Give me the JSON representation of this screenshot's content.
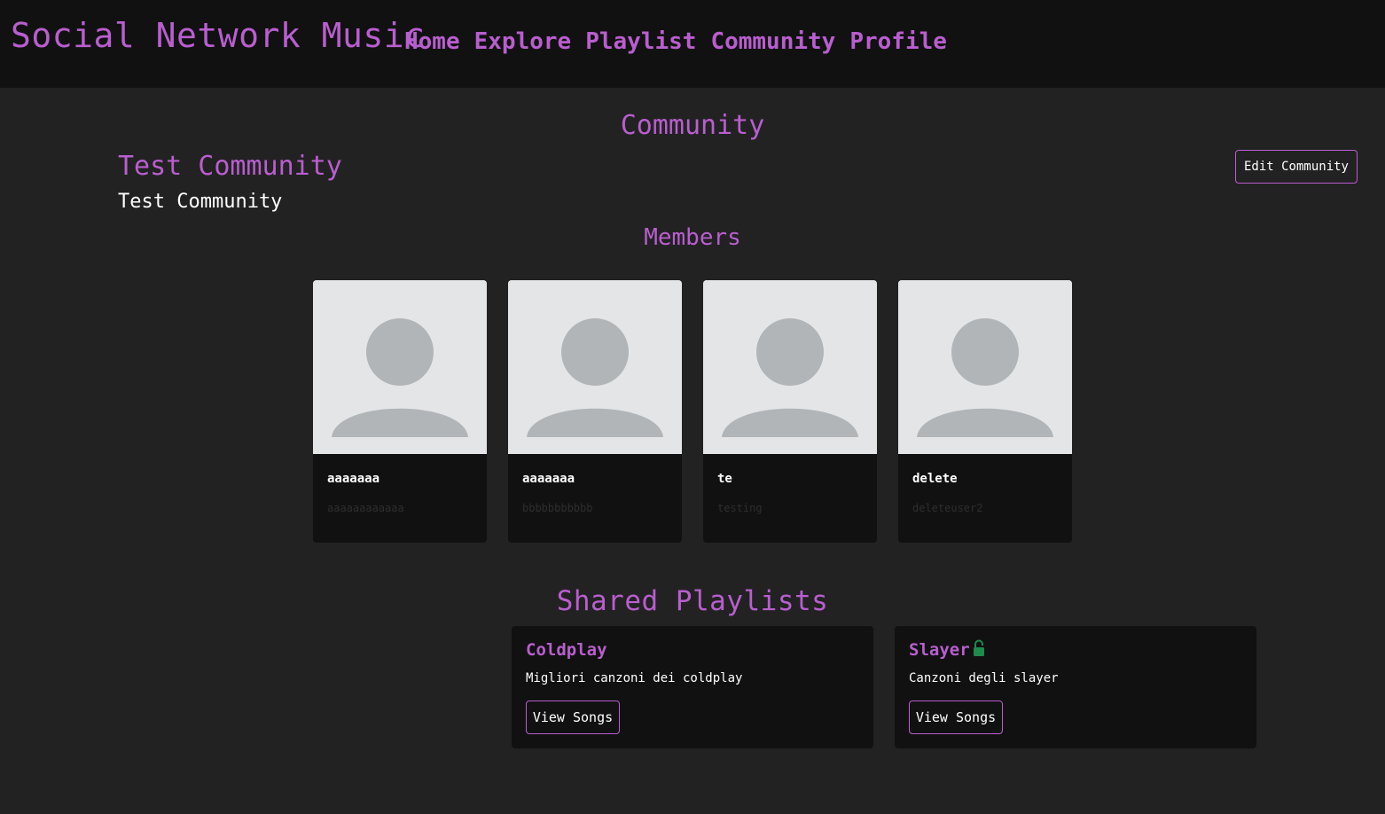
{
  "navbar": {
    "brand": "Social Network Music",
    "links": [
      "Home",
      "Explore",
      "Playlist",
      "Community",
      "Profile"
    ]
  },
  "page": {
    "title": "Community",
    "community_name": "Test Community",
    "community_description": "Test Community",
    "edit_button_label": "Edit Community",
    "members_title": "Members",
    "shared_playlists_title": "Shared Playlists"
  },
  "members": [
    {
      "name": "aaaaaaa",
      "username": "aaaaaaaaaaaa",
      "avatar_icon": "user-placeholder-icon"
    },
    {
      "name": "aaaaaaa",
      "username": "bbbbbbbbbbb",
      "avatar_icon": "user-placeholder-icon"
    },
    {
      "name": "te",
      "username": "testing",
      "avatar_icon": "user-placeholder-icon"
    },
    {
      "name": "delete",
      "username": "deleteuser2",
      "avatar_icon": "user-placeholder-icon"
    }
  ],
  "playlists": [
    {
      "name": "Coldplay",
      "description": "Migliori canzoni dei coldplay",
      "button_label": "View Songs",
      "locked": false
    },
    {
      "name": "Slayer",
      "description": "Canzoni degli slayer",
      "button_label": "View Songs",
      "locked": true,
      "lock_icon": "unlocked-padlock-icon"
    }
  ],
  "colors": {
    "accent": "#b95ecf",
    "background": "#222222",
    "navbar": "#111111",
    "card": "#111111",
    "lock": "#1e8b4c"
  }
}
